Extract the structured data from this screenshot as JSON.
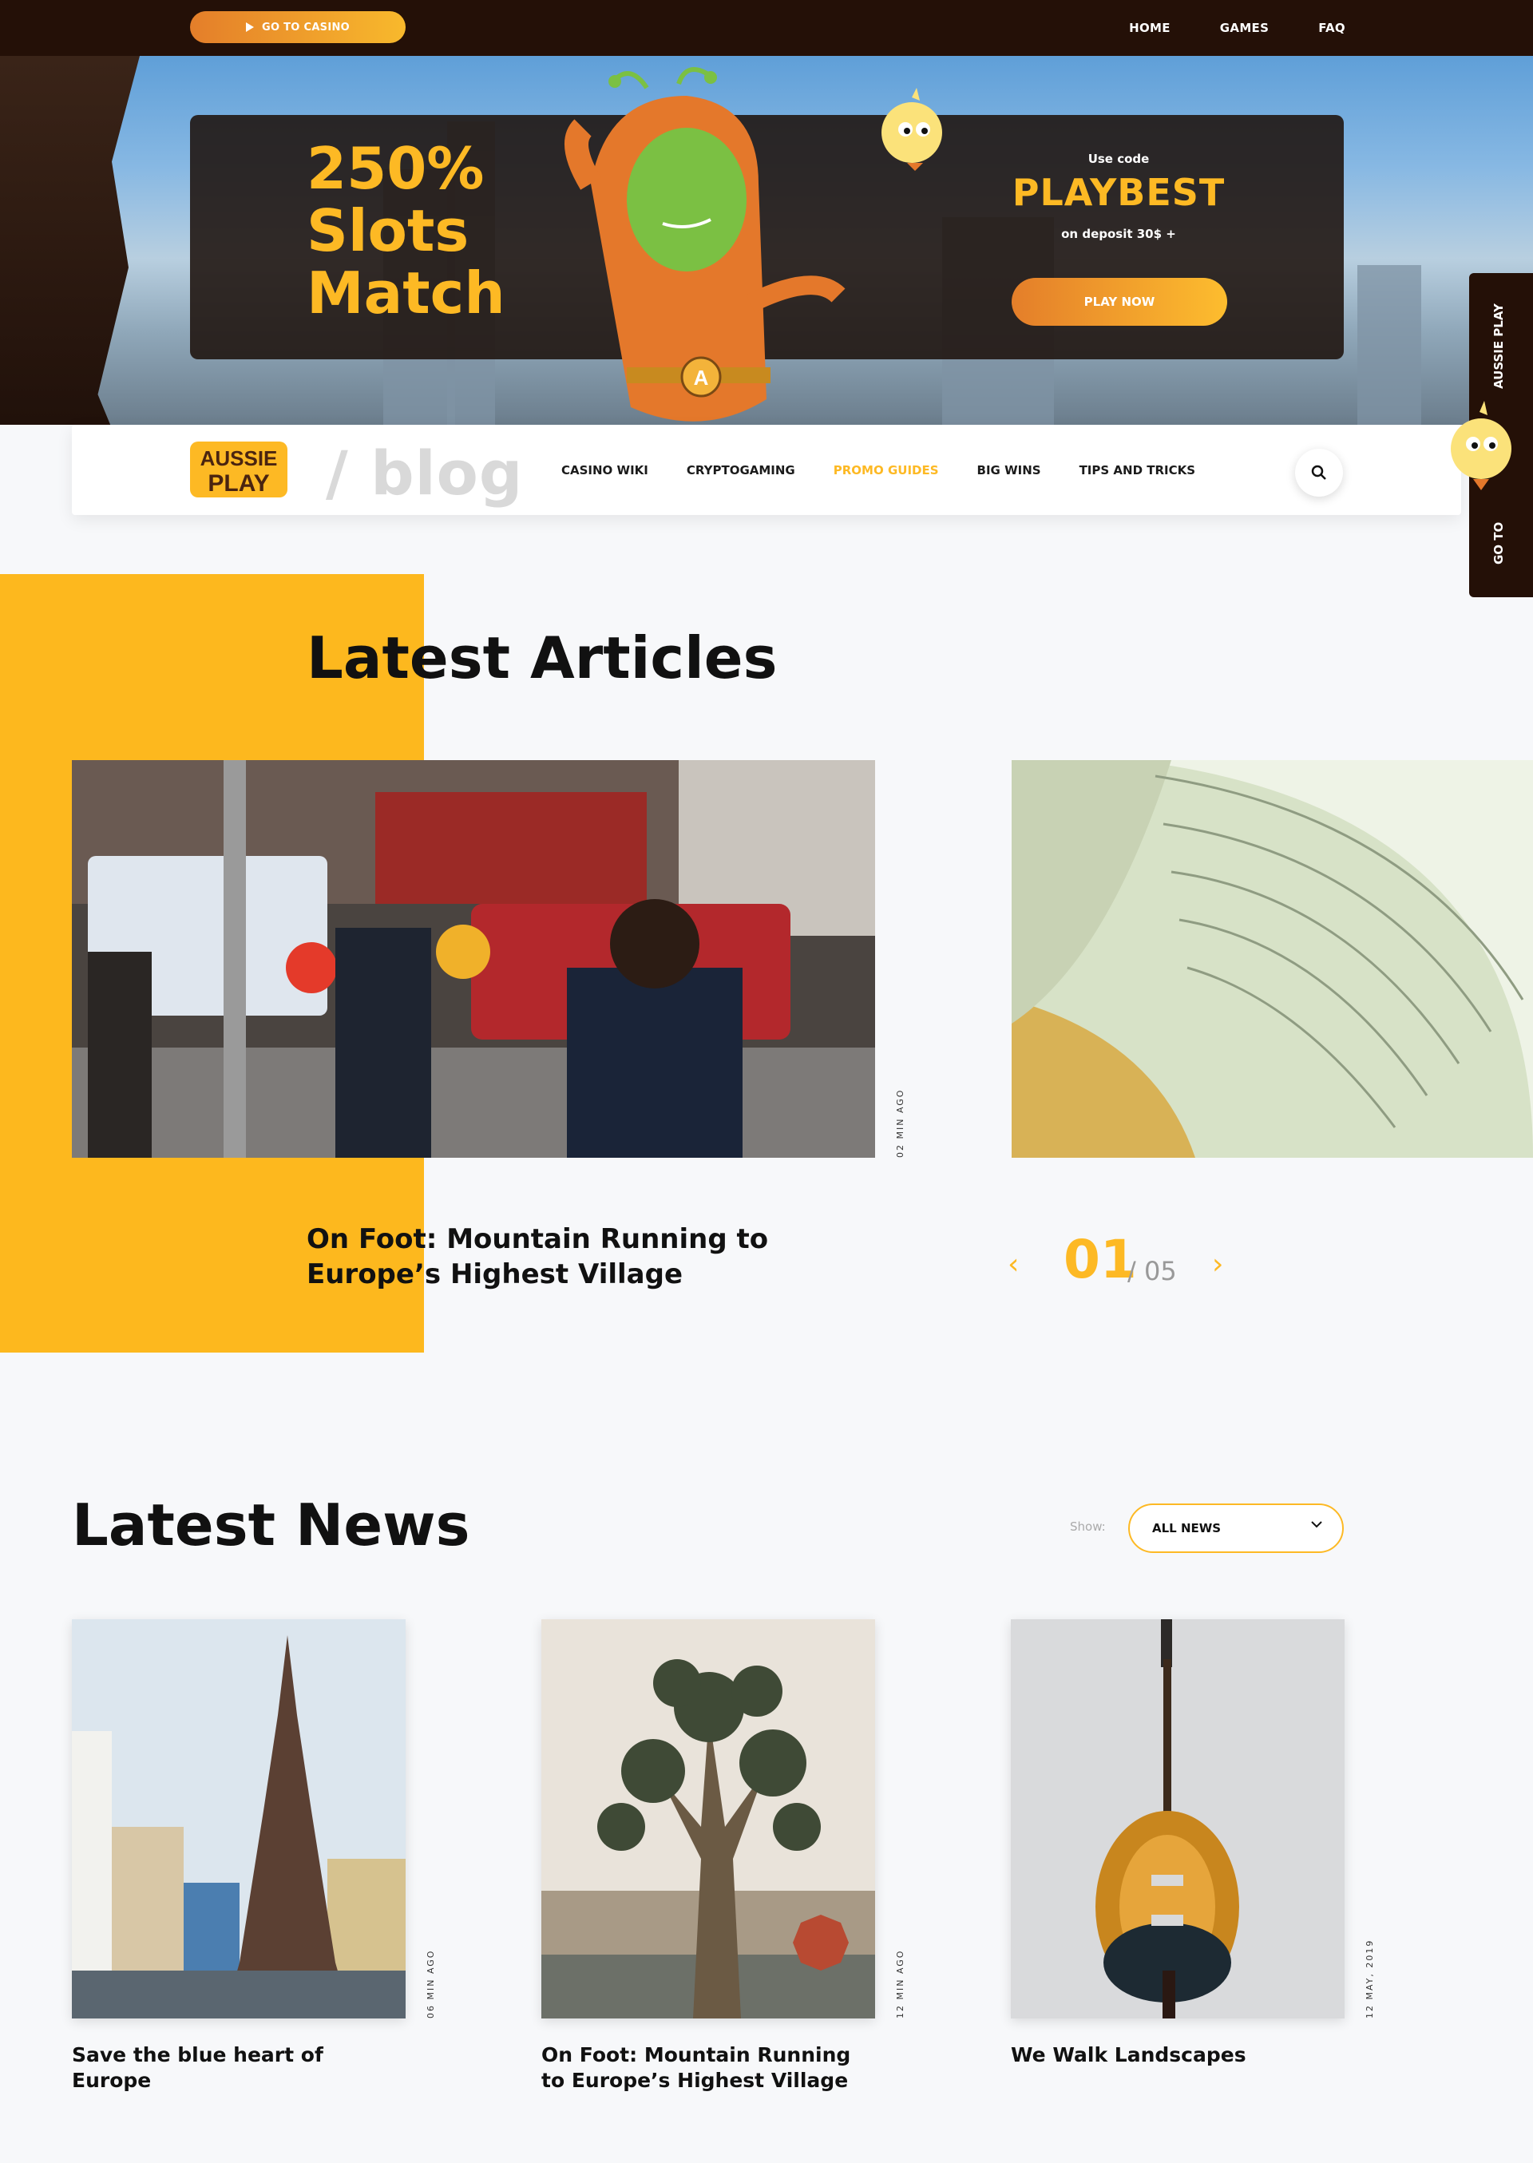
{
  "topbar": {
    "goto_casino": "GO TO CASINO",
    "nav": [
      "HOME",
      "GAMES",
      "FAQ"
    ]
  },
  "hero": {
    "promo_lines": [
      "250%",
      "Slots",
      "Match"
    ],
    "use_code_label": "Use code",
    "code": "PLAYBEST",
    "deposit_note": "on deposit 30$ +",
    "cta": "PLAY NOW"
  },
  "navbar": {
    "logo_text": [
      "AUSSIE",
      "PLAY"
    ],
    "blog_label": "/ blog",
    "categories": [
      {
        "label": "CASINO WIKI",
        "active": false
      },
      {
        "label": "CRYPTOGAMING",
        "active": false
      },
      {
        "label": "PROMO GUIDES",
        "active": true
      },
      {
        "label": "BIG WINS",
        "active": false
      },
      {
        "label": "TIPS AND TRICKS",
        "active": false
      }
    ],
    "search_icon": "search-icon"
  },
  "sidetab": {
    "label_top": "AUSSIE PLAY",
    "label_bottom": "GO TO"
  },
  "articles": {
    "heading": "Latest Articles",
    "featured": {
      "time": "02 MIN AGO",
      "title": "On Foot: Mountain Running to Europe’s Highest Village"
    },
    "slider": {
      "current": "01",
      "total": "/ 05"
    }
  },
  "news": {
    "heading": "Latest News",
    "show_label": "Show:",
    "filter_value": "ALL NEWS",
    "items": [
      {
        "title": "Save the blue heart of Europe",
        "time": "06 MIN AGO"
      },
      {
        "title": "On Foot: Mountain Running to Europe’s Highest Village",
        "time": "12 MIN AGO"
      },
      {
        "title": "We Walk Landscapes",
        "time": "12 MAY, 2019"
      }
    ]
  },
  "colors": {
    "brand_yellow": "#fdb924",
    "dark_brown": "#241007",
    "orange": "#e47e2a"
  }
}
